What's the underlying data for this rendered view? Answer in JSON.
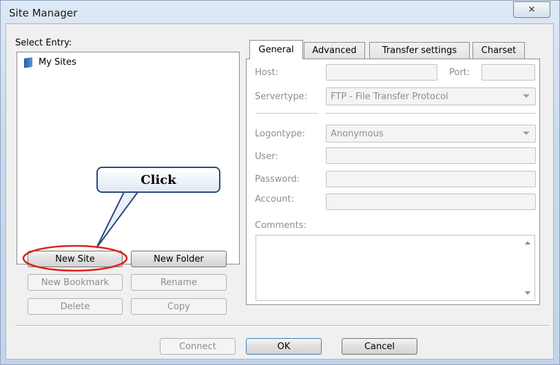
{
  "window": {
    "title": "Site Manager"
  },
  "tree": {
    "label": "Select Entry:",
    "items": [
      {
        "label": "My Sites"
      }
    ]
  },
  "left_buttons": {
    "new_site": "New Site",
    "new_folder": "New Folder",
    "new_bookmark": "New Bookmark",
    "rename": "Rename",
    "delete": "Delete",
    "copy": "Copy"
  },
  "tabs": [
    {
      "label": "General",
      "active": true
    },
    {
      "label": "Advanced",
      "active": false
    },
    {
      "label": "Transfer settings",
      "active": false
    },
    {
      "label": "Charset",
      "active": false
    }
  ],
  "general": {
    "host_label": "Host:",
    "host_value": "",
    "port_label": "Port:",
    "port_value": "",
    "servertype_label": "Servertype:",
    "servertype_value": "FTP - File Transfer Protocol",
    "logontype_label": "Logontype:",
    "logontype_value": "Anonymous",
    "user_label": "User:",
    "password_label": "Password:",
    "account_label": "Account:",
    "comments_label": "Comments:"
  },
  "bottom_buttons": {
    "connect": "Connect",
    "ok": "OK",
    "cancel": "Cancel"
  },
  "annotation": {
    "text": "Click",
    "highlight_color": "#e0201b",
    "bubble_border": "#2b4a7c"
  },
  "icons": {
    "close": "close-icon",
    "folder": "folder-icon"
  }
}
